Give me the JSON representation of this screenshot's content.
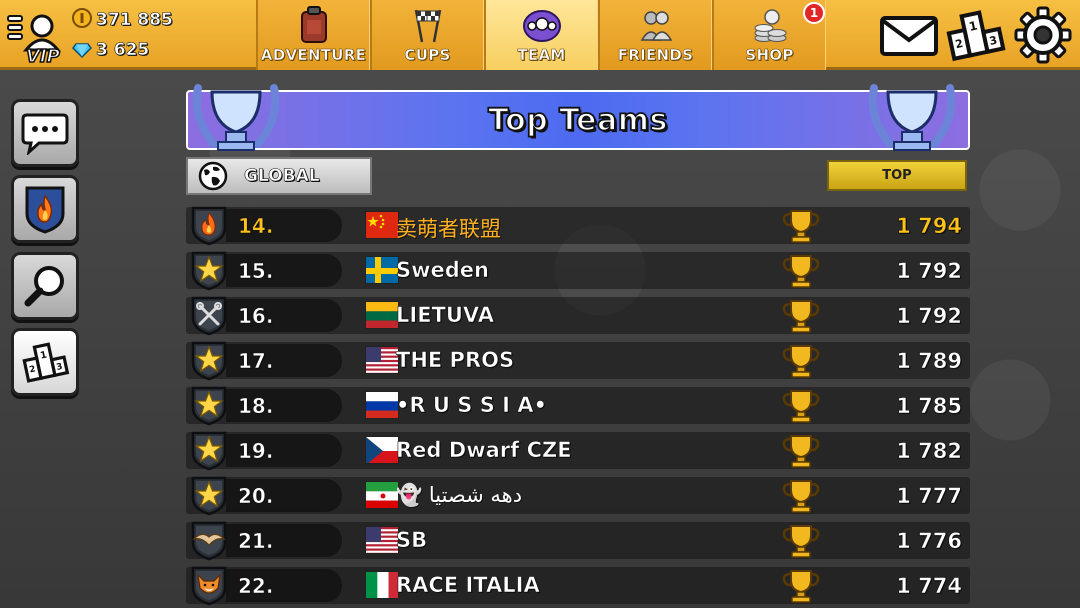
{
  "header": {
    "vip_label": "VIP",
    "coins": "371 885",
    "gems": "3 625"
  },
  "nav": {
    "tabs": [
      {
        "label": "ADVENTURE",
        "icon": "fuel-can-icon",
        "active": false
      },
      {
        "label": "CUPS",
        "icon": "checkered-flags-icon",
        "active": false
      },
      {
        "label": "TEAM",
        "icon": "team-emblem-icon",
        "active": true
      },
      {
        "label": "FRIENDS",
        "icon": "friends-icon",
        "active": false
      },
      {
        "label": "SHOP",
        "icon": "coin-stack-icon",
        "active": false,
        "badge": "1"
      }
    ]
  },
  "top_right": {
    "mail_icon": "mail-icon",
    "leaderboard_icon": "podium-icon",
    "settings_icon": "gear-icon"
  },
  "sidebar": {
    "items": [
      {
        "icon": "chat-bubble-icon",
        "active": false
      },
      {
        "icon": "team-badge-flame-icon",
        "active": false
      },
      {
        "icon": "magnifier-icon",
        "active": false
      },
      {
        "icon": "podium-icon",
        "active": true
      }
    ]
  },
  "main": {
    "title": "Top Teams",
    "scope_label": "GLOBAL",
    "top_button_label": "TOP"
  },
  "teams": [
    {
      "rank": "14.",
      "name": "卖萌者联盟",
      "score": "1 794",
      "flag": "china",
      "emblem": "flame",
      "highlight": true
    },
    {
      "rank": "15.",
      "name": "Sweden",
      "score": "1 792",
      "flag": "sweden",
      "emblem": "star"
    },
    {
      "rank": "16.",
      "name": "LIETUVA",
      "score": "1 792",
      "flag": "lithuania",
      "emblem": "wrenches"
    },
    {
      "rank": "17.",
      "name": "THE PROS",
      "score": "1 789",
      "flag": "usa",
      "emblem": "star"
    },
    {
      "rank": "18.",
      "name": "•R U S S I A•",
      "score": "1 785",
      "flag": "russia",
      "emblem": "star"
    },
    {
      "rank": "19.",
      "name": "Red Dwarf CZE",
      "score": "1 782",
      "flag": "czech",
      "emblem": "star"
    },
    {
      "rank": "20.",
      "name": "👻  دهه شصتیا",
      "score": "1 777",
      "flag": "iran",
      "emblem": "star"
    },
    {
      "rank": "21.",
      "name": "SB",
      "score": "1 776",
      "flag": "usa",
      "emblem": "wings"
    },
    {
      "rank": "22.",
      "name": "RACE ITALIA",
      "score": "1 774",
      "flag": "italy",
      "emblem": "fox"
    }
  ],
  "colors": {
    "topbar": "#f2b233",
    "banner": "#5a74f0",
    "highlight": "#ffc21a",
    "top_button": "#f2d23a"
  }
}
